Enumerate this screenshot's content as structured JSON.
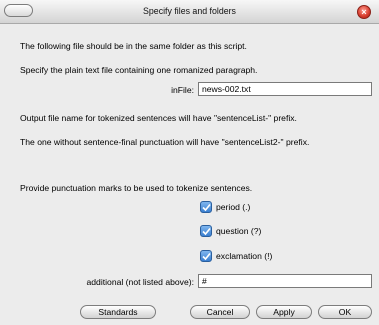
{
  "window": {
    "title": "Specify files and folders"
  },
  "lines": {
    "same_folder": "The following file should be in the same folder as this script.",
    "specify_plain": "Specify the plain text file containing one romanized paragraph.",
    "output_name": "Output file name for tokenized sentences will have \"sentenceList-\" prefix.",
    "no_final_punct": "The one without sentence-final punctuation will have \"sentenceList2-\" prefix.",
    "provide_punct": "Provide punctuation marks to be used to tokenize sentences."
  },
  "infile": {
    "label": "inFile:",
    "value": "news-002.txt"
  },
  "punctuation": [
    {
      "label": "period (.)",
      "checked": true
    },
    {
      "label": "question (?)",
      "checked": true
    },
    {
      "label": "exclamation (!)",
      "checked": true
    }
  ],
  "additional": {
    "label": "additional (not listed above):",
    "value": "#"
  },
  "buttons": {
    "standards": "Standards",
    "cancel": "Cancel",
    "apply": "Apply",
    "ok": "OK"
  },
  "colors": {
    "checkbox": "#3a7fd0",
    "close": "#d63b2c"
  }
}
